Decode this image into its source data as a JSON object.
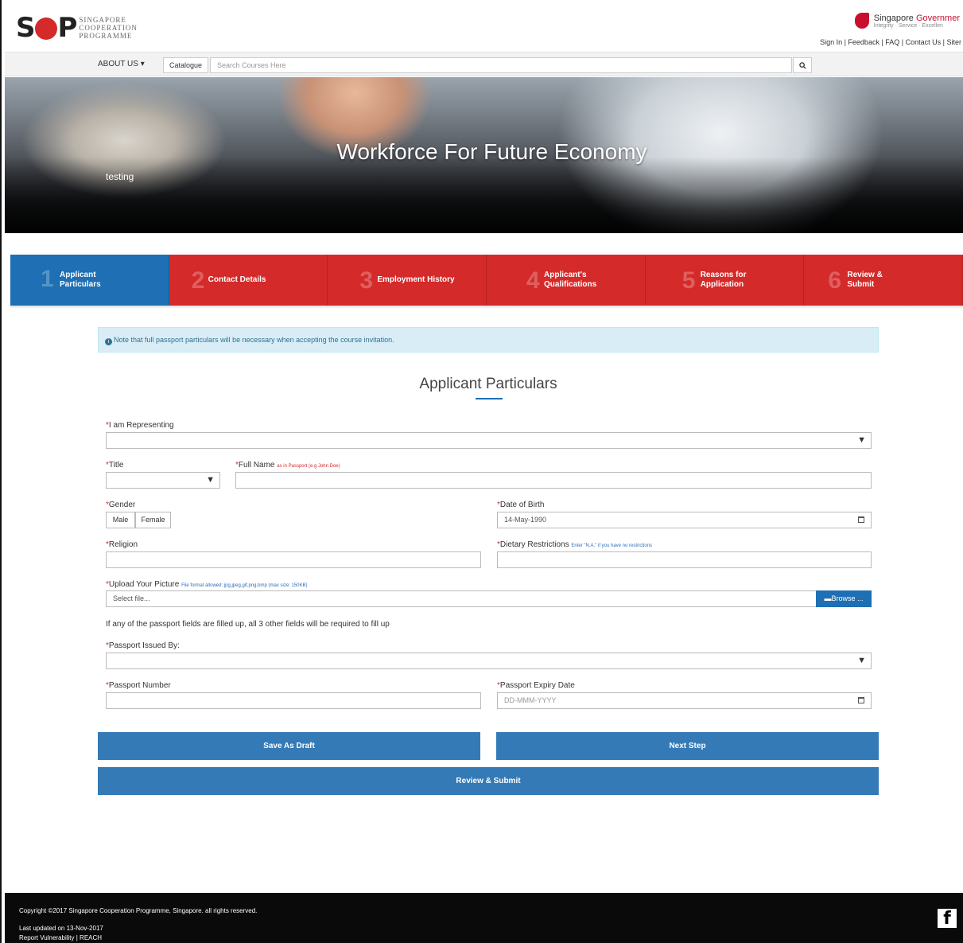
{
  "header": {
    "logo_mark": "SCP",
    "logo_lines": [
      "SINGAPORE",
      "COOPERATION",
      "PROGRAMME"
    ],
    "gov_title_a": "Singapore ",
    "gov_title_b": "Governmer",
    "gov_tagline": "Integrity · Service · Excellen",
    "top_links": "Sign In | Feedback | FAQ | Contact Us | Siter"
  },
  "nav": {
    "about": "ABOUT US ▾",
    "catalogue": "Catalogue",
    "search_placeholder": "Search Courses Here"
  },
  "hero": {
    "title": "Workforce For Future Economy",
    "subtitle": "testing"
  },
  "steps": [
    {
      "num": "1",
      "label": "Applicant Particulars",
      "active": true
    },
    {
      "num": "2",
      "label": "Contact Details",
      "active": false
    },
    {
      "num": "3",
      "label": "Employment History",
      "active": false
    },
    {
      "num": "4",
      "label": "Applicant's Qualifications",
      "active": false
    },
    {
      "num": "5",
      "label": "Reasons for Application",
      "active": false
    },
    {
      "num": "6",
      "label": "Review & Submit",
      "active": false
    }
  ],
  "notice": "Note that full passport particulars will be necessary when accepting the course invitation.",
  "form": {
    "title": "Applicant Particulars",
    "representing_label": "I am Representing",
    "title_label": "Title",
    "fullname_label": "Full Name",
    "fullname_hint": "as in Passport (e.g John Doe)",
    "gender_label": "Gender",
    "gender_male": "Male",
    "gender_female": "Female",
    "dob_label": "Date of Birth",
    "dob_value": "14-May-1990",
    "religion_label": "Religion",
    "dietary_label": "Dietary Restrictions",
    "dietary_hint": "Enter \"N.A.\" if you have no restrictions",
    "upload_label": "Upload Your Picture",
    "upload_hint": "File format allowed: jpg,jpeg,gif,png,bmp (max size: 150KB)",
    "upload_placeholder": "Select file...",
    "browse": "Browse ...",
    "passport_note": "If any of the passport fields are filled up, all 3 other fields will be required to fill up",
    "passport_issued_label": "Passport Issued By:",
    "passport_number_label": "Passport Number",
    "passport_expiry_label": "Passport Expiry Date",
    "passport_expiry_placeholder": "DD-MMM-YYYY"
  },
  "buttons": {
    "save_draft": "Save As Draft",
    "next_step": "Next Step",
    "review_submit": "Review & Submit"
  },
  "footer": {
    "copyright": "Copyright ©2017 Singapore Cooperation Programme, Singapore. all rights reserved.",
    "updated": "Last updated on 13-Nov-2017",
    "links": "Report Vulnerability | REACH",
    "fb": "f"
  },
  "colors": {
    "step_active": "#1e6fb3",
    "step_inactive": "#d42a2a",
    "button": "#337ab7",
    "required": "#d42a2a"
  }
}
